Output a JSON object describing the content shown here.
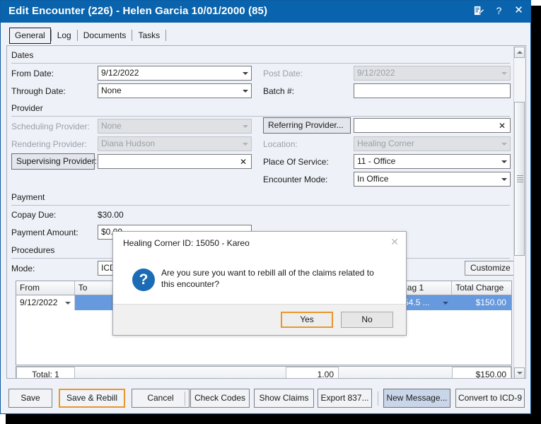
{
  "window": {
    "title": "Edit Encounter (226) -  Helen  Garcia  10/01/2000 (85)",
    "title_icons": [
      {
        "name": "notes-icon",
        "glyph": "📝"
      },
      {
        "name": "help-icon",
        "glyph": "?"
      },
      {
        "name": "close-icon",
        "glyph": "✕"
      }
    ]
  },
  "tabs": [
    {
      "label": "General",
      "active": true
    },
    {
      "label": "Log",
      "active": false
    },
    {
      "label": "Documents",
      "active": false
    },
    {
      "label": "Tasks",
      "active": false
    }
  ],
  "sections": {
    "dates": {
      "title": "Dates",
      "from_date_label": "From Date:",
      "from_date_value": "9/12/2022",
      "through_date_label": "Through Date:",
      "through_date_value": "None",
      "post_date_label": "Post Date:",
      "post_date_value": "9/12/2022",
      "batch_label": "Batch #:",
      "batch_value": ""
    },
    "provider": {
      "title": "Provider",
      "scheduling_label": "Scheduling Provider:",
      "scheduling_value": "None",
      "rendering_label": "Rendering Provider:",
      "rendering_value": "Diana Hudson",
      "supervising_label": "Supervising Provider:",
      "supervising_value": "",
      "referring_label": "Referring Provider...",
      "referring_value": "",
      "location_label": "Location:",
      "location_value": "Healing Corner",
      "pos_label": "Place Of Service:",
      "pos_value": "11 - Office",
      "encounter_mode_label": "Encounter Mode:",
      "encounter_mode_value": "In Office"
    },
    "payment": {
      "title": "Payment",
      "copay_label": "Copay Due:",
      "copay_value": "$30.00",
      "amount_label": "Payment Amount:",
      "amount_value": "$0.00"
    },
    "procedures": {
      "title": "Procedures",
      "mode_label": "Mode:",
      "mode_value": "ICD",
      "customize_label": "Customize"
    }
  },
  "grid": {
    "columns": [
      "From",
      "To",
      "Diag 1",
      "Total Charge"
    ],
    "rows": [
      {
        "from": "9/12/2022",
        "to": "",
        "diag1": "154.5 ...",
        "total_charge": "$150.00"
      }
    ],
    "total_label": "Total: 1",
    "total_units": "1.00",
    "total_charge": "$150.00"
  },
  "footer_buttons": [
    {
      "label": "Save",
      "state": "normal"
    },
    {
      "label": "Save & Rebill",
      "state": "highlight"
    },
    {
      "label": "Cancel",
      "state": "normal"
    },
    {
      "label": "Check Codes",
      "state": "normal"
    },
    {
      "label": "Show Claims",
      "state": "normal"
    },
    {
      "label": "Export 837...",
      "state": "normal"
    },
    {
      "label": "New Message...",
      "state": "focused"
    },
    {
      "label": "Convert to ICD-9",
      "state": "normal"
    }
  ],
  "dialog": {
    "title": "Healing Corner ID: 15050 - Kareo",
    "close_glyph": "✕",
    "icon_glyph": "?",
    "message": "Are you sure you want to rebill all of the claims related to this encounter?",
    "yes_label": "Yes",
    "no_label": "No"
  },
  "colors": {
    "titlebar": "#0a64ad",
    "highlight_orange": "#e8972a",
    "row_selected": "#6699dd",
    "dialog_icon": "#1b6cb5"
  }
}
